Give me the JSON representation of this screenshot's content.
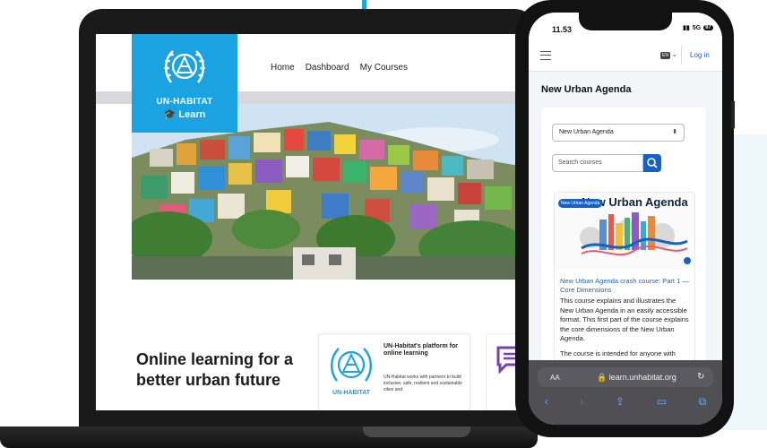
{
  "laptop": {
    "nav": {
      "home": "Home",
      "dashboard": "Dashboard",
      "my_courses": "My Courses"
    },
    "logo": {
      "line1": "UN-HABITAT",
      "line2": "Learn"
    },
    "headline": "Online learning for a better urban future",
    "card": {
      "logo_label": "UN-HABITAT",
      "title": "UN-Habitat's platform for online learning",
      "body": "UN-Habitat works with partners to build inclusive, safe, resilient and sustainable cities and"
    }
  },
  "phone": {
    "status": {
      "time": "11.53",
      "network": "5G",
      "battery": "97"
    },
    "app_bar": {
      "lang_code": "EN",
      "login": "Log in"
    },
    "page_heading": "New Urban Agenda",
    "course_select": {
      "value": "New Urban Agenda"
    },
    "search": {
      "placeholder": "Search courses"
    },
    "course": {
      "image_title": "New Urban Agenda",
      "badge": "New Urban Agenda",
      "link": "New Urban Agenda crash course: Part 1 — Core Dimensions",
      "description": "This course explains and illustrates the New Urban Agenda in an easily accessible format. This first part of the course explains the core dimensions of the New Urban Agenda.",
      "description2": "The course is intended for anyone with"
    },
    "browser": {
      "text_size": "AA",
      "url": "learn.unhabitat.org"
    }
  },
  "colors": {
    "brand": "#1aa3e0",
    "link": "#1662c4"
  }
}
